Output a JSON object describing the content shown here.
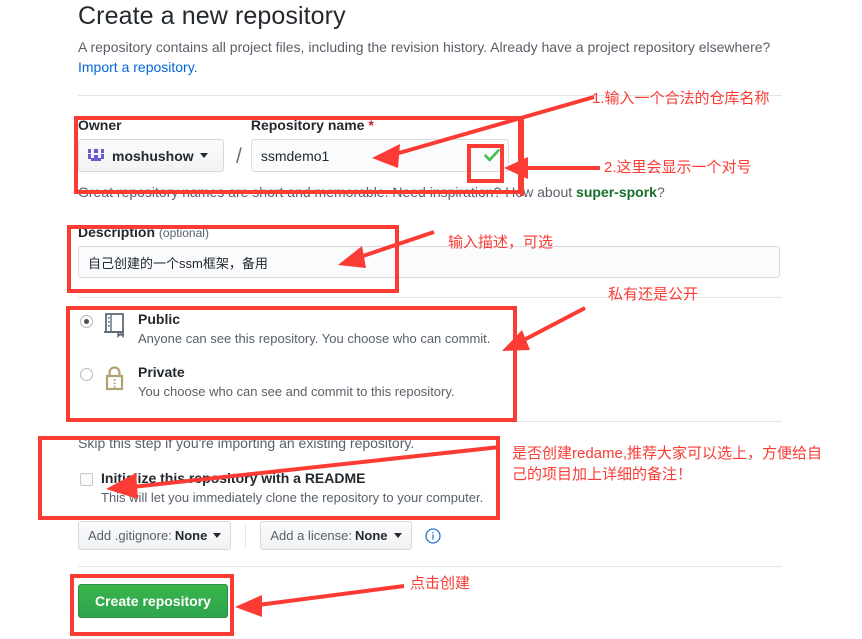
{
  "header": {
    "title": "Create a new repository",
    "subtitle": "A repository contains all project files, including the revision history. Already have a project repository elsewhere?",
    "import_link": "Import a repository."
  },
  "owner": {
    "label": "Owner",
    "name": "moshushow",
    "avatar_icon": "identicon-avatar",
    "caret_icon": "chevron-down-icon",
    "separator": "/"
  },
  "repo_name": {
    "label": "Repository name",
    "required_marker": "*",
    "value": "ssmdemo1",
    "placeholder": "",
    "valid_icon": "green-check-icon",
    "hint_prefix": "Great repository names are short and memorable. Need inspiration? How about ",
    "hint_suggestion": "super-spork",
    "hint_suffix": "?"
  },
  "description": {
    "label": "Description",
    "optional_label": "(optional)",
    "value": "自己创建的一个ssm框架，备用",
    "placeholder": ""
  },
  "visibility": {
    "options": [
      {
        "id": "public",
        "title": "Public",
        "desc": "Anyone can see this repository. You choose who can commit.",
        "icon": "book-icon",
        "selected": true
      },
      {
        "id": "private",
        "title": "Private",
        "desc": "You choose who can see and commit to this repository.",
        "icon": "lock-icon",
        "selected": false
      }
    ]
  },
  "initialize": {
    "skip_note": "Skip this step if you're importing an existing repository.",
    "checkbox_label": "Initialize this repository with a README",
    "checkbox_desc": "This will let you immediately clone the repository to your computer.",
    "checked": false
  },
  "extras": {
    "gitignore_label": "Add .gitignore:",
    "gitignore_value": "None",
    "license_label": "Add a license:",
    "license_value": "None",
    "info_icon": "info-circle-icon",
    "caret_icon": "chevron-down-icon"
  },
  "submit": {
    "label": "Create repository"
  },
  "colors": {
    "annotation": "#fb3b34",
    "link": "#0366d6",
    "green_button": "#2da44e",
    "check_green": "#3fbf4f",
    "suggestion_green": "#176f2c",
    "lock_tan": "#b3a271",
    "book_blue": "#5f6b7a",
    "avatar_purple": "#6a5bd6"
  },
  "annotations": [
    {
      "id": "a1",
      "text": "1.输入一个合法的仓库名称"
    },
    {
      "id": "a2",
      "text": "2.这里会显示一个对号"
    },
    {
      "id": "a3",
      "text": "输入描述，可选"
    },
    {
      "id": "a4",
      "text": "私有还是公开"
    },
    {
      "id": "a5",
      "text": "是否创建redame,推荐大家可以选上，方便给自\n己的项目加上详细的备注！"
    },
    {
      "id": "a6",
      "text": "点击创建"
    }
  ]
}
